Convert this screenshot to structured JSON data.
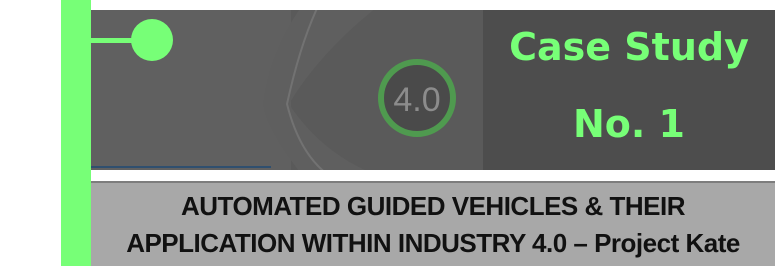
{
  "header": {
    "title_line1": "Case Study",
    "title_line2": "No. 1"
  },
  "banner": {
    "badge_text": "4.0"
  },
  "subtitle": {
    "line1": "AUTOMATED GUIDED VEHICLES & THEIR",
    "line2": "APPLICATION WITHIN INDUSTRY 4.0 – Project Kate"
  },
  "colors": {
    "accent": "#77ff77",
    "banner_bg": "#5a5a5a",
    "panel_bg": "#4d4d4d",
    "subtitle_bg": "#a8a8a8"
  },
  "icons": {
    "connector": "timeline-node-icon",
    "badge": "industry-4-0-badge-icon"
  }
}
